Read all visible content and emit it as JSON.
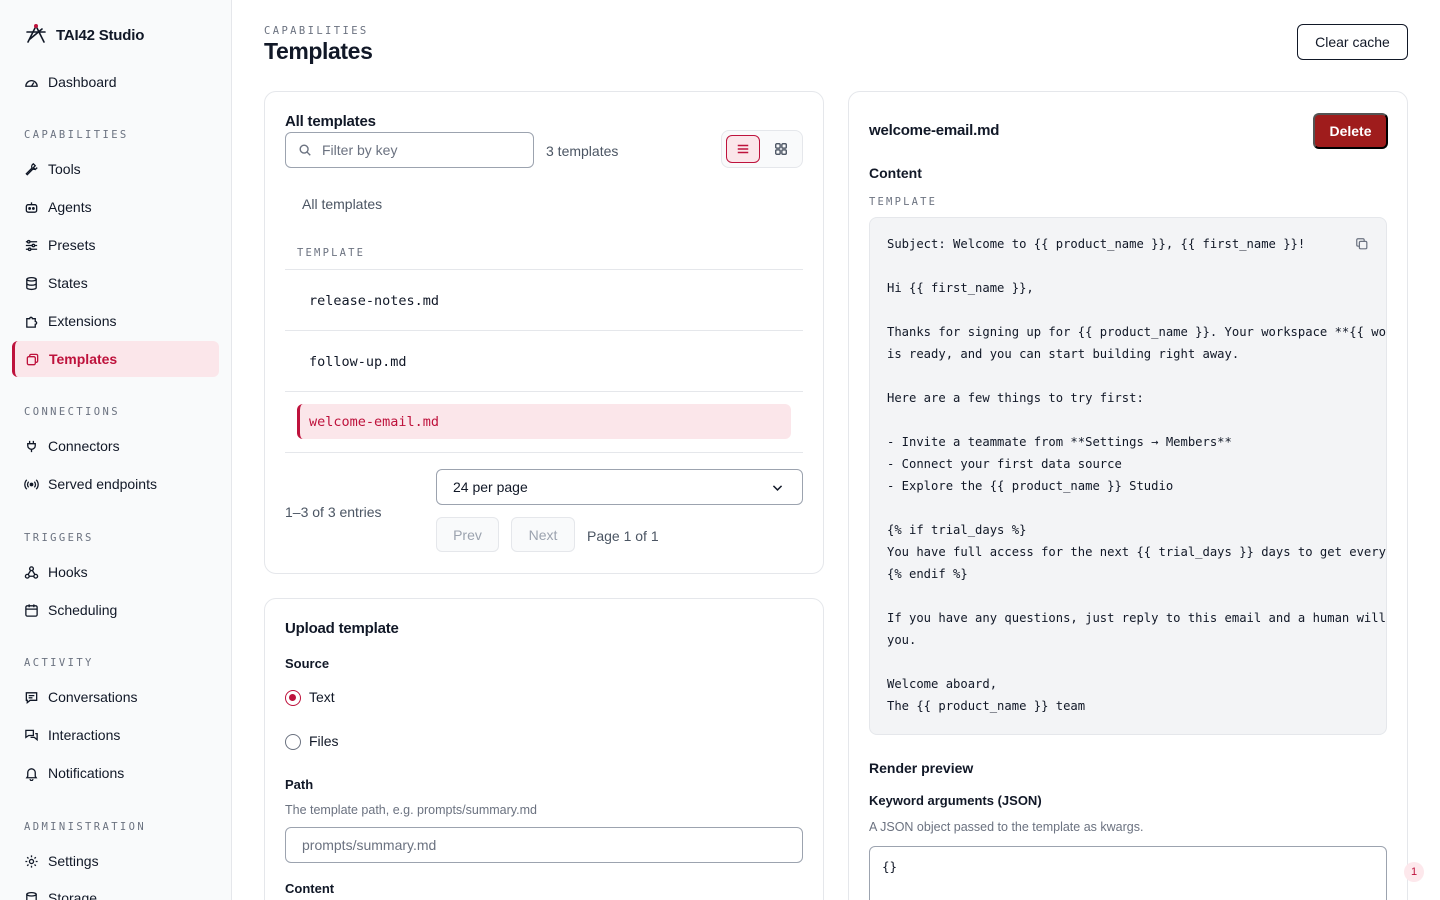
{
  "app": {
    "name": "TAI42 Studio"
  },
  "sidebar": {
    "dashboard": "Dashboard",
    "sections": {
      "capabilities": "CAPABILITIES",
      "connections": "CONNECTIONS",
      "triggers": "TRIGGERS",
      "activity": "ACTIVITY",
      "administration": "ADMINISTRATION"
    },
    "capabilities": [
      "Tools",
      "Agents",
      "Presets",
      "States",
      "Extensions",
      "Templates"
    ],
    "connections": [
      "Connectors",
      "Served endpoints"
    ],
    "triggers": [
      "Hooks",
      "Scheduling"
    ],
    "activity": [
      "Conversations",
      "Interactions",
      "Notifications"
    ],
    "administration": [
      "Settings",
      "Storage"
    ],
    "active_item": "Templates"
  },
  "header": {
    "eyebrow": "CAPABILITIES",
    "title": "Templates",
    "clear_cache": "Clear cache"
  },
  "templates_list": {
    "title": "All templates",
    "filter_placeholder": "Filter by key",
    "count_label": "3 templates",
    "group_label": "All templates",
    "column_header": "TEMPLATE",
    "rows": [
      "release-notes.md",
      "follow-up.md",
      "welcome-email.md"
    ],
    "selected": "welcome-email.md",
    "entries_label": "1–3 of 3 entries",
    "per_page": "24 per page",
    "prev": "Prev",
    "next": "Next",
    "page_label": "Page 1 of 1"
  },
  "upload": {
    "title": "Upload template",
    "source_label": "Source",
    "source_options": [
      "Text",
      "Files"
    ],
    "source_selected": "Text",
    "path_label": "Path",
    "path_help": "The template path, e.g. prompts/summary.md",
    "path_placeholder": "prompts/summary.md",
    "content_label": "Content"
  },
  "detail": {
    "filename": "welcome-email.md",
    "delete": "Delete",
    "content_label": "Content",
    "template_caps": "TEMPLATE",
    "code_lines": [
      "Subject: Welcome to {{ product_name }}, {{ first_name }}!",
      "",
      "Hi {{ first_name }},",
      "",
      "Thanks for signing up for {{ product_name }}. Your workspace **{{ workspace_name }}**",
      "is ready, and you can start building right away.",
      "",
      "Here are a few things to try first:",
      "",
      "- Invite a teammate from **Settings → Members**",
      "- Connect your first data source",
      "- Explore the {{ product_name }} Studio",
      "",
      "{% if trial_days %}",
      "You have full access for the next {{ trial_days }} days to get everything set up.",
      "{% endif %}",
      "",
      "If you have any questions, just reply to this email and a human will get back to",
      "you.",
      "",
      "Welcome aboard,",
      "The {{ product_name }} team"
    ],
    "render_preview": "Render preview",
    "kwargs_label": "Keyword arguments (JSON)",
    "kwargs_help": "A JSON object passed to the template as kwargs.",
    "kwargs_value": "{}"
  },
  "notification_badge": "1",
  "colors": {
    "accent": "#be123c",
    "accent_bg": "#fbe6ea",
    "danger": "#9f1c1c"
  }
}
